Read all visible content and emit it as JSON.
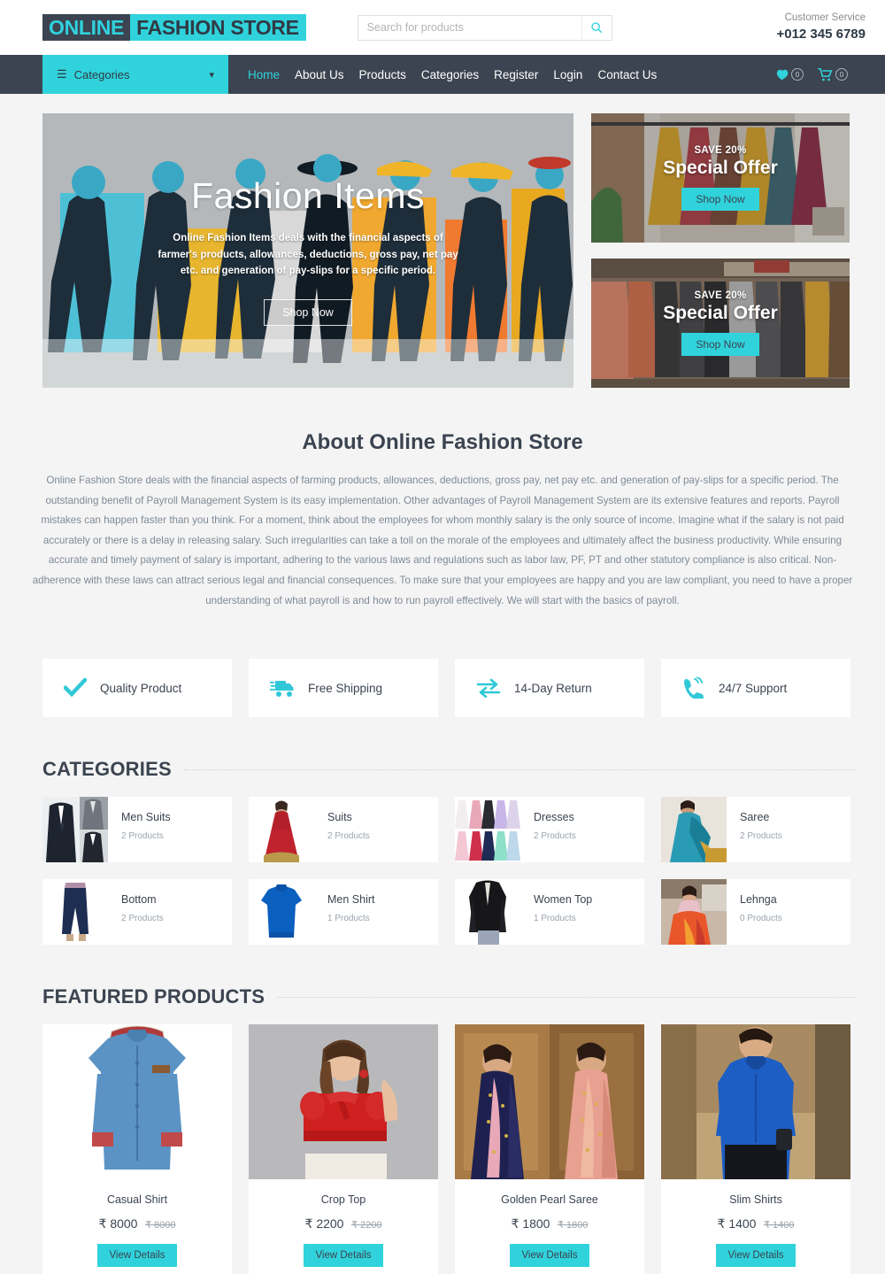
{
  "header": {
    "logo": {
      "part1": "ONLINE",
      "part2": "FASHION STORE"
    },
    "search": {
      "placeholder": "Search for products",
      "value": ""
    },
    "customer_service": {
      "label": "Customer Service",
      "phone": "+012 345 6789"
    }
  },
  "nav": {
    "categories_button": "Categories",
    "links": [
      {
        "label": "Home",
        "active": true
      },
      {
        "label": "About Us",
        "active": false
      },
      {
        "label": "Products",
        "active": false
      },
      {
        "label": "Categories",
        "active": false
      },
      {
        "label": "Register",
        "active": false
      },
      {
        "label": "Login",
        "active": false
      },
      {
        "label": "Contact Us",
        "active": false
      }
    ],
    "wishlist_count": "0",
    "cart_count": "0"
  },
  "hero": {
    "title": "Fashion Items",
    "description": "Online Fashion Items deals with the financial aspects of farmer's products, allowances, deductions, gross pay, net pay etc. and generation of pay-slips for a specific period.",
    "button": "Shop Now"
  },
  "offers": [
    {
      "save": "SAVE 20%",
      "title": "Special Offer",
      "button": "Shop Now"
    },
    {
      "save": "SAVE 20%",
      "title": "Special Offer",
      "button": "Shop Now"
    }
  ],
  "about": {
    "title": "About Online Fashion Store",
    "text": "Online Fashion Store deals with the financial aspects of farming products, allowances, deductions, gross pay, net pay etc. and generation of pay-slips for a specific period. The outstanding benefit of Payroll Management System is its easy implementation. Other advantages of Payroll Management System are its extensive features and reports. Payroll mistakes can happen faster than you think. For a moment, think about the employees for whom monthly salary is the only source of income. Imagine what if the salary is not paid accurately or there is a delay in releasing salary. Such irregularities can take a toll on the morale of the employees and ultimately affect the business productivity. While ensuring accurate and timely payment of salary is important, adhering to the various laws and regulations such as labor law, PF, PT and other statutory compliance is also critical. Non-adherence with these laws can attract serious legal and financial consequences. To make sure that your employees are happy and you are law compliant, you need to have a proper understanding of what payroll is and how to run payroll effectively. We will start with the basics of payroll."
  },
  "features": [
    {
      "icon": "check-icon",
      "label": "Quality Product"
    },
    {
      "icon": "truck-icon",
      "label": "Free Shipping"
    },
    {
      "icon": "exchange-icon",
      "label": "14-Day Return"
    },
    {
      "icon": "phone-icon",
      "label": "24/7 Support"
    }
  ],
  "categories_section": {
    "title": "CATEGORIES",
    "items": [
      {
        "name": "Men Suits",
        "count": "2 Products"
      },
      {
        "name": "Suits",
        "count": "2 Products"
      },
      {
        "name": "Dresses",
        "count": "2 Products"
      },
      {
        "name": "Saree",
        "count": "2 Products"
      },
      {
        "name": "Bottom",
        "count": "2 Products"
      },
      {
        "name": "Men Shirt",
        "count": "1 Products"
      },
      {
        "name": "Women Top",
        "count": "1 Products"
      },
      {
        "name": "Lehnga",
        "count": "0 Products"
      }
    ]
  },
  "featured_section": {
    "title": "FEATURED PRODUCTS",
    "items": [
      {
        "name": "Casual Shirt",
        "price": "₹ 8000",
        "old_price": "₹ 8000",
        "button": "View Details"
      },
      {
        "name": "Crop Top",
        "price": "₹ 2200",
        "old_price": "₹ 2200",
        "button": "View Details"
      },
      {
        "name": "Golden Pearl Saree",
        "price": "₹ 1800",
        "old_price": "₹ 1800",
        "button": "View Details"
      },
      {
        "name": "Slim Shirts",
        "price": "₹ 1400",
        "old_price": "₹ 1400",
        "button": "View Details"
      }
    ]
  },
  "colors": {
    "accent": "#30d3dc",
    "dark": "#3b4450",
    "page_bg": "#f4f4f4",
    "muted_text": "#7f8a96"
  }
}
